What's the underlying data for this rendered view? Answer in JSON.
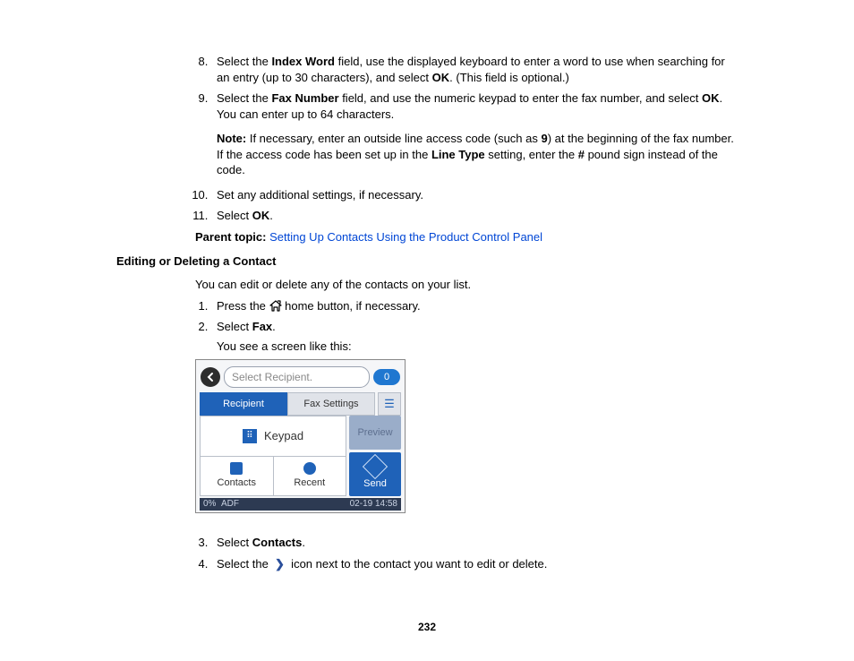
{
  "steps_part1": {
    "n8": "8.",
    "s8_a": "Select the ",
    "s8_b": "Index Word",
    "s8_c": " field, use the displayed keyboard to enter a word to use when searching for an entry (up to 30 characters), and select ",
    "s8_d": "OK",
    "s8_e": ". (This field is optional.)",
    "n9": "9.",
    "s9_a": "Select the ",
    "s9_b": "Fax Number",
    "s9_c": " field, and use the numeric keypad to enter the fax number, and select ",
    "s9_d": "OK",
    "s9_e": ". You can enter up to 64 characters.",
    "note_label": "Note:",
    "note_a": " If necessary, enter an outside line access code (such as ",
    "note_b": "9",
    "note_c": ") at the beginning of the fax number. If the access code has been set up in the ",
    "note_d": "Line Type",
    "note_e": " setting, enter the ",
    "note_f": "#",
    "note_g": " pound sign instead of the code.",
    "n10": "10.",
    "s10": "Set any additional settings, if necessary.",
    "n11": "11.",
    "s11_a": "Select ",
    "s11_b": "OK",
    "s11_c": "."
  },
  "parent_topic_label": "Parent topic:",
  "parent_topic_link": "Setting Up Contacts Using the Product Control Panel",
  "heading": "Editing or Deleting a Contact",
  "intro": "You can edit or delete any of the contacts on your list.",
  "steps_part2": {
    "n1": "1.",
    "s1_a": "Press the ",
    "s1_b": " home button, if necessary.",
    "n2": "2.",
    "s2_a": "Select ",
    "s2_b": "Fax",
    "s2_c": ".",
    "s2_sub": "You see a screen like this:",
    "n3": "3.",
    "s3_a": "Select ",
    "s3_b": "Contacts",
    "s3_c": ".",
    "n4": "4.",
    "s4_a": "Select the ",
    "s4_b": " icon next to the contact you want to edit or delete."
  },
  "device": {
    "select_recipient": "Select Recipient.",
    "badge": "0",
    "tab_recipient": "Recipient",
    "tab_fax_settings": "Fax Settings",
    "keypad": "Keypad",
    "contacts": "Contacts",
    "recent": "Recent",
    "preview": "Preview",
    "send": "Send",
    "status_pct": "0%",
    "status_adf": "ADF",
    "status_time": "02-19 14:58"
  },
  "page_number": "232"
}
